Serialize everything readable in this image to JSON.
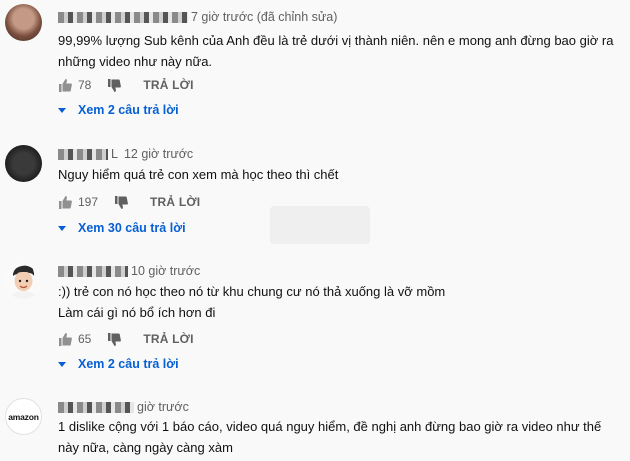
{
  "comments": [
    {
      "time": "7 giờ trước (đã chỉnh sửa)",
      "text": "99,99% lượng Sub kênh của Anh đều là trẻ dưới vị thành niên. nên e mong anh đừng bao giờ ra những video như này nữa.",
      "likes": "78",
      "reply_label": "TRẢ LỜI",
      "view_replies": "Xem 2 câu trả lời"
    },
    {
      "name_suffix": "L",
      "time": "12 giờ trước",
      "text": "Nguy hiểm quá trẻ con xem mà học theo thì chết",
      "likes": "197",
      "reply_label": "TRẢ LỜI",
      "view_replies": "Xem 30 câu trả lời"
    },
    {
      "time": "10 giờ trước",
      "text_line1": ":)) trẻ con nó học theo nó từ khu chung cư nó thả xuống là vỡ mồm",
      "text_line2": "Làm cái gì nó bổ ích hơn đi",
      "likes": "65",
      "reply_label": "TRẢ LỜI",
      "view_replies": "Xem 2 câu trả lời"
    },
    {
      "avatar_text": "amazon",
      "time": "giờ trước",
      "text": "1 dislike cộng với 1 báo cáo, video quá nguy hiểm, đề nghị anh đừng bao giờ ra video như thế này nữa, càng ngày càng xàm"
    }
  ],
  "icons": {
    "like": "thumb-up-icon",
    "dislike": "thumb-down-icon",
    "expand": "caret-down-icon"
  },
  "colors": {
    "link": "#065fd4",
    "meta": "#606060"
  }
}
